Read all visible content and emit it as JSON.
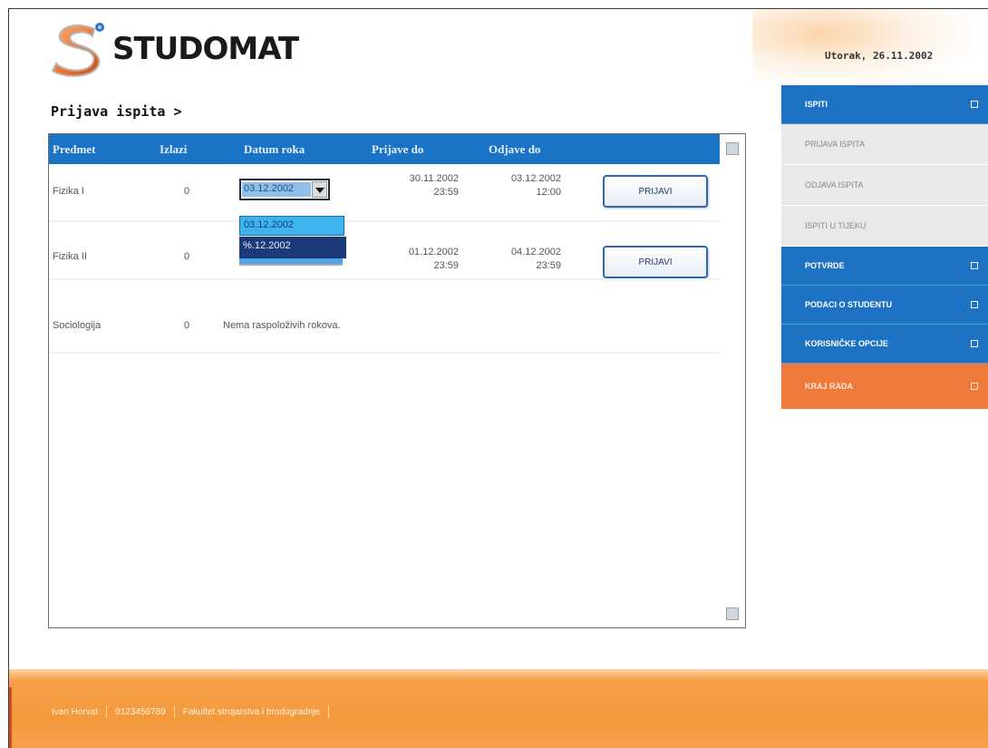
{
  "header": {
    "brand": "STUDOMAT",
    "date": "Utorak, 26.11.2002"
  },
  "page": {
    "title": "Prijava ispita >"
  },
  "table": {
    "columns": [
      "Predmet",
      "Izlazi",
      "Datum roka",
      "Prijave do",
      "Odjave do"
    ],
    "rows": [
      {
        "subject": "Fizika I",
        "count": "0",
        "date_select": "03.12.2002",
        "prijave_date": "30.11.2002",
        "prijave_time": "23:59",
        "odjave_date": "03.12.2002",
        "odjave_time": "12:00",
        "button": "PRIJAVI"
      },
      {
        "subject": "Fizika II",
        "count": "0",
        "prijave_date": "01.12.2002",
        "prijave_time": "23:59",
        "odjave_date": "04.12.2002",
        "odjave_time": "23:59",
        "button": "PRIJAVI"
      },
      {
        "subject": "Sociologija",
        "count": "0",
        "message": "Nema raspoloživih rokova."
      }
    ],
    "dropdown_options": [
      "03.12.2002",
      "%.12.2002"
    ]
  },
  "sidebar": {
    "items": [
      {
        "label": "ISPITI"
      },
      {
        "label": "PRIJAVA ISPITA"
      },
      {
        "label": "ODJAVA ISPITA"
      },
      {
        "label": "ISPITI U TIJEKU"
      },
      {
        "label": "POTVRDE"
      },
      {
        "label": "PODACI O STUDENTU"
      },
      {
        "label": "KORISNIČKE OPCIJE"
      },
      {
        "label": "KRAJ RADA"
      }
    ]
  },
  "footer": {
    "links": [
      "Ivan Horvat",
      "0123456789",
      "Fakultet strojarstva i brodogradnje"
    ]
  },
  "colors": {
    "accent_blue": "#1e72c3",
    "orange": "#f39a3c",
    "logout": "#ef7a3c"
  }
}
